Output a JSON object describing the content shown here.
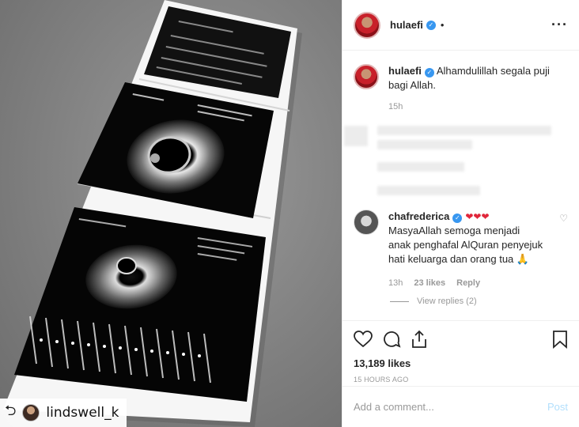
{
  "post": {
    "username": "hulaefi",
    "verified_icon": "verified-badge-icon",
    "separator": "•",
    "more_icon": "more-options-icon",
    "caption_text": "Alhamdulillah segala puji bagi Allah.",
    "caption_age": "15h"
  },
  "repost": {
    "icon": "repost-icon",
    "username": "lindswell_k"
  },
  "comment": {
    "username": "chafrederica",
    "emoji": "❤❤❤",
    "text": "MasyaAllah semoga menjadi anak penghafal AlQuran penyejuk hati keluarga dan orang tua 🙏",
    "age": "13h",
    "likes": "23 likes",
    "reply_label": "Reply",
    "view_replies": "View replies (2)"
  },
  "actions": {
    "like_count": "13,189 likes",
    "timestamp": "15 HOURS AGO"
  },
  "composer": {
    "placeholder": "Add a comment...",
    "post_label": "Post"
  },
  "colors": {
    "link_blue": "#3897f0",
    "heart_red": "#e0263a",
    "post_disabled": "#b2dffc"
  }
}
